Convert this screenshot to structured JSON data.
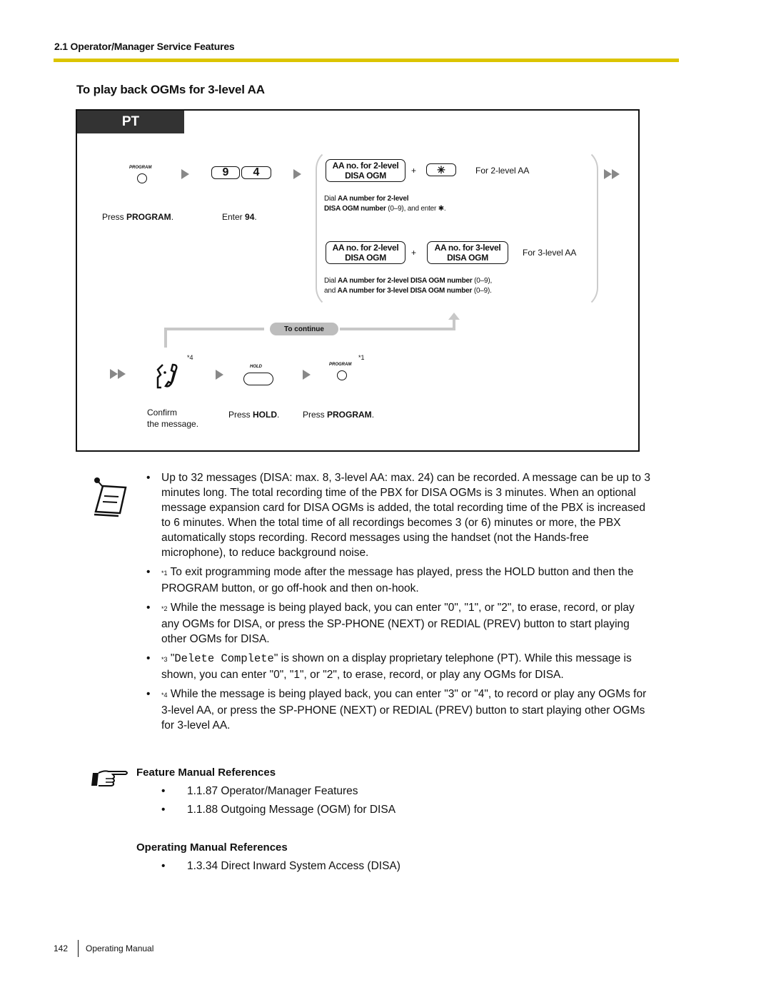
{
  "header": {
    "section": "2.1 Operator/Manager Service Features",
    "accent_color": "#dcc400"
  },
  "title": "To play back OGMs for 3-level AA",
  "diagram": {
    "tab": "PT",
    "step1": {
      "button_label": "PROGRAM",
      "icon": "round-button-icon",
      "caption_prefix": "Press ",
      "caption_bold": "PROGRAM",
      "caption_suffix": "."
    },
    "step2": {
      "keys": [
        "9",
        "4"
      ],
      "caption_prefix": "Enter ",
      "caption_bold": "94",
      "caption_suffix": "."
    },
    "option_2level": {
      "box_line1": "AA no. for 2-level",
      "box_line2": "DISA OGM",
      "plus": "+",
      "star_key": "✳",
      "label": "For 2-level AA",
      "desc1_prefix": "Dial ",
      "desc1_bold": "AA number for 2-level",
      "desc2_bold": "DISA OGM number",
      "desc2_suffix": " (0–9), and enter ✱."
    },
    "option_3level": {
      "box1_line1": "AA no. for 2-level",
      "box1_line2": "DISA OGM",
      "plus": "+",
      "box2_line1": "AA no. for 3-level",
      "box2_line2": "DISA OGM",
      "label": "For 3-level AA",
      "desc1_prefix": "Dial ",
      "desc1_bold": "AA number for 2-level DISA OGM number",
      "desc1_suffix": " (0–9),",
      "desc2_prefix": "and ",
      "desc2_bold": "AA number for 3-level DISA OGM number",
      "desc2_suffix": " (0–9)."
    },
    "continue_label": "To continue",
    "step3": {
      "icon": "handset-listen-icon",
      "note": "*4",
      "caption_line1": "Confirm",
      "caption_line2": "the message."
    },
    "step4": {
      "button_label": "HOLD",
      "caption_prefix": "Press ",
      "caption_bold": "HOLD",
      "caption_suffix": "."
    },
    "step5": {
      "button_label": "PROGRAM",
      "note": "*1",
      "caption_prefix": "Press ",
      "caption_bold": "PROGRAM",
      "caption_suffix": "."
    }
  },
  "notes": [
    {
      "sup": "",
      "text": "Up to 32 messages (DISA: max. 8, 3-level AA: max. 24) can be recorded. A message can be up to 3 minutes long. The total recording time of the PBX for DISA OGMs is 3 minutes. When an optional message expansion card for DISA OGMs is added, the total recording time of the PBX is increased to 6 minutes. When the total time of all recordings becomes 3 (or 6) minutes or more, the PBX automatically stops recording. Record messages using the handset (not the Hands-free microphone), to reduce background noise."
    },
    {
      "sup": "*1",
      "text": " To exit programming mode after the message has played, press the HOLD button and then the PROGRAM button, or go off-hook and then on-hook."
    },
    {
      "sup": "*2",
      "text": " While the message is being played back, you can enter \"0\", \"1\", or \"2\", to erase, record, or play any OGMs for DISA, or press the SP-PHONE (NEXT) or REDIAL (PREV) button to start playing other OGMs for DISA."
    },
    {
      "sup": "*3",
      "mono": "Delete Complete",
      "text_before": " \"",
      "text": "\" is shown on a display proprietary telephone (PT). While this message is shown, you can enter \"0\", \"1\", or \"2\", to erase, record, or play any OGMs for DISA."
    },
    {
      "sup": "*4",
      "text": " While the message is being played back, you can enter \"3\" or \"4\", to record or play any OGMs for 3-level AA, or press the SP-PHONE (NEXT) or REDIAL (PREV) button to start playing other OGMs for 3-level AA."
    }
  ],
  "bullet": "•",
  "feature_refs": {
    "heading": "Feature Manual References",
    "items": [
      "1.1.87 Operator/Manager Features",
      "1.1.88 Outgoing Message (OGM) for DISA"
    ]
  },
  "operating_refs": {
    "heading": "Operating Manual References",
    "items": [
      "1.3.34 Direct Inward System Access (DISA)"
    ]
  },
  "footer": {
    "page": "142",
    "label": "Operating Manual"
  }
}
